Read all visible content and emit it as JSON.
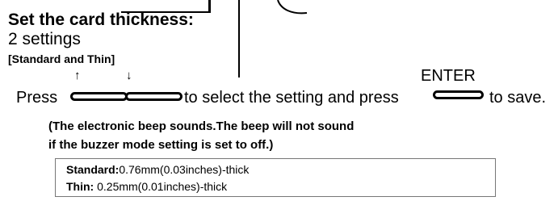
{
  "heading": "Set the card thickness:",
  "settings_count": "2 settings",
  "settings_list": "[Standard and Thin]",
  "arrow_up": "↑",
  "arrow_down": "↓",
  "enter_label": "ENTER",
  "instruction": {
    "press": "Press",
    "middle": "to select the setting and press",
    "end": "to save."
  },
  "note_line1": "(The electronic beep sounds.The beep will not sound",
  "note_line2": "if the buzzer mode setting is set to off.)",
  "options": [
    {
      "label": "Standard:",
      "value": "0.76mm(0.03inches)-thick"
    },
    {
      "label": "Thin:",
      "value": " 0.25mm(0.01inches)-thick"
    }
  ]
}
